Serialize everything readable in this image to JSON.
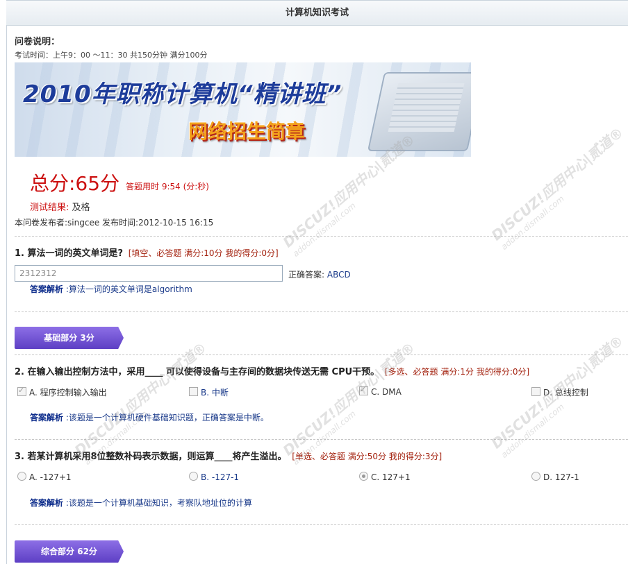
{
  "page": {
    "title": "计算机知识考试"
  },
  "survey": {
    "desc_title": "问卷说明：",
    "desc_text": "考试时间：上午9：00 ～11：30  共150分钟  满分100分",
    "banner_line1": "2010年职称计算机“精讲班”",
    "banner_line2": "网络招生简章"
  },
  "score": {
    "total_label": "总分:65分",
    "time_used": "答题用时 9:54 (分:秒)",
    "result_label": "测试结果:",
    "result_value": "及格",
    "publisher": "本问卷发布者:singcee 发布时间:2012-10-15 16:15"
  },
  "watermark": {
    "brand": "DISCUZ!应用中心|贰道®",
    "domain": "addon.dismall.com"
  },
  "questions": [
    {
      "title": "1. 算法一词的英文单词是?",
      "meta": "[填空、必答题   满分:10分   我的得分:0分]",
      "input_value": "2312312",
      "correct_label": "正确答案:",
      "correct_value": "ABCD",
      "analysis_label": "答案解析",
      "analysis_text": ":算法一词的英文单词是algorithm"
    },
    {
      "title": "2. 在输入输出控制方法中，采用____ 可以使得设备与主存间的数据块传送无需 CPU干预。",
      "meta": "[多选、必答题   满分:1分   我的得分:0分]",
      "options": [
        "A. 程序控制输入输出",
        "B. 中断",
        "C. DMA",
        "D. 总线控制"
      ],
      "analysis_label": "答案解析",
      "analysis_text": ":该题是一个计算机硬件基础知识题，正确答案是中断。"
    },
    {
      "title": "3. 若某计算机采用8位整数补码表示数据，则运算____将产生溢出。",
      "meta": "[单选、必答题   满分:50分  我的得分:3分]",
      "options": [
        "A. -127+1",
        "B. -127-1",
        "C. 127+1",
        "D. 127-1"
      ],
      "analysis_label": "答案解析",
      "analysis_text": ":该题是一个计算机基础知识，考察队地址位的计算"
    }
  ],
  "sections": [
    {
      "label": "基础部分 3分"
    },
    {
      "label": "综合部分 62分"
    }
  ]
}
